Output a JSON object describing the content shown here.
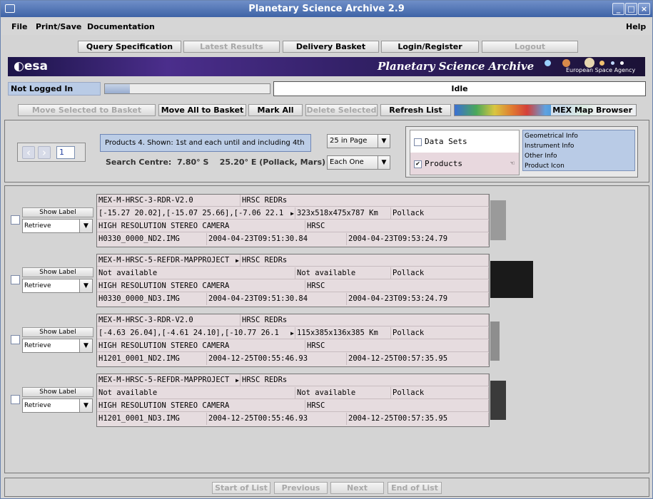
{
  "window": {
    "title": "Planetary Science Archive 2.9"
  },
  "menu": {
    "file": "File",
    "print_save": "Print/Save",
    "documentation": "Documentation",
    "help": "Help"
  },
  "nav": {
    "query": "Query Specification",
    "latest": "Latest Results",
    "delivery": "Delivery Basket",
    "login": "Login/Register",
    "logout": "Logout"
  },
  "banner": {
    "logo": "esa",
    "title": "Planetary Science Archive",
    "agency": "European Space Agency"
  },
  "status": {
    "login": "Not Logged In",
    "state": "Idle",
    "progress": 0.15
  },
  "actions": {
    "move_selected": "Move Selected to Basket",
    "move_all": "Move All to Basket",
    "mark_all": "Mark All",
    "delete_selected": "Delete Selected",
    "refresh": "Refresh List",
    "map_browser": "MEX Map Browser"
  },
  "controls": {
    "page_number": "1",
    "products_info": "Products 4. Shown: 1st  and each until and including  4th",
    "search_centre_label": "Search Centre:",
    "search_lat": "7.80° S",
    "search_lon": "25.20° E (Pollack, Mars)",
    "per_page": "25 in Page",
    "each": "Each One",
    "datasets": "Data Sets",
    "products": "Products",
    "info_options": [
      "Geometrical Info",
      "Instrument Info",
      "Other Info",
      "Product Icon"
    ]
  },
  "row_controls": {
    "show_label": "Show Label",
    "retrieve": "Retrieve"
  },
  "products": [
    {
      "dataset": "MEX-M-HRSC-3-RDR-V2.0",
      "type": "HRSC REDRs",
      "coords": "[-15.27 20.02],[-15.07 25.66],[-7.06 22.1",
      "size": "323x518x475x787 Km",
      "target": "Pollack",
      "instrument": "HIGH RESOLUTION STEREO CAMERA",
      "inst_id": "HRSC",
      "file": "H0330_0000_ND2.IMG",
      "start": "2004-04-23T09:51:30.84",
      "stop": "2004-04-23T09:53:24.79"
    },
    {
      "dataset": "MEX-M-HRSC-5-REFDR-MAPPROJECT",
      "type": "HRSC REDRs",
      "coords": "Not available",
      "size": "Not available",
      "target": "Pollack",
      "instrument": "HIGH RESOLUTION STEREO CAMERA",
      "inst_id": "HRSC",
      "file": "H0330_0000_ND3.IMG",
      "start": "2004-04-23T09:51:30.84",
      "stop": "2004-04-23T09:53:24.79"
    },
    {
      "dataset": "MEX-M-HRSC-3-RDR-V2.0",
      "type": "HRSC REDRs",
      "coords": "[-4.63 26.04],[-4.61 24.10],[-10.77 26.1",
      "size": "115x385x136x385 Km",
      "target": "Pollack",
      "instrument": "HIGH RESOLUTION STEREO CAMERA",
      "inst_id": "HRSC",
      "file": "H1201_0001_ND2.IMG",
      "start": "2004-12-25T00:55:46.93",
      "stop": "2004-12-25T00:57:35.95"
    },
    {
      "dataset": "MEX-M-HRSC-5-REFDR-MAPPROJECT",
      "type": "HRSC REDRs",
      "coords": "Not available",
      "size": "Not available",
      "target": "Pollack",
      "instrument": "HIGH RESOLUTION STEREO CAMERA",
      "inst_id": "HRSC",
      "file": "H1201_0001_ND3.IMG",
      "start": "2004-12-25T00:55:46.93",
      "stop": "2004-12-25T00:57:35.95"
    }
  ],
  "bottom_nav": {
    "start": "Start of List",
    "previous": "Previous",
    "next": "Next",
    "end": "End of List"
  }
}
